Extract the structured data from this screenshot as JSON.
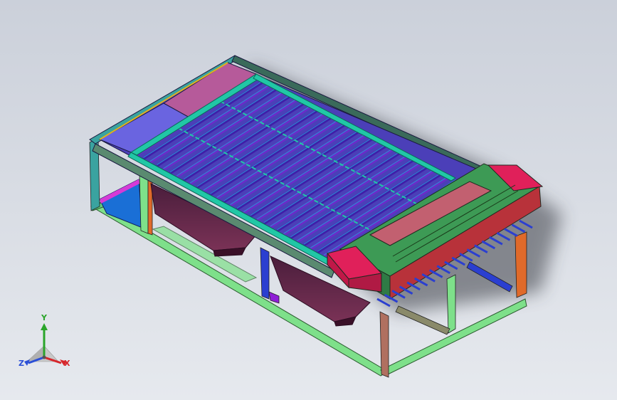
{
  "viewport": {
    "background_top": "#cbd0da",
    "background_bottom": "#e6e9ee"
  },
  "model": {
    "colors": {
      "frame_green": "#7ee08a",
      "frame_teal": "#3aa3a0",
      "leg_orange": "#e06a2a",
      "leg_blue": "#2b3fd0",
      "leg_purple": "#8f1fd6",
      "panel_blue": "#6a64e0",
      "panel_pink": "#b65a9a",
      "rollers": "#3f1fa8",
      "roller_frame": "#21c7a6",
      "hopper": "#6a2a4e",
      "gear_red": "#e0205a",
      "gear_green": "#3d9a55",
      "mid_panel": "#1a6fd6"
    }
  },
  "triad": {
    "y_label": "Y",
    "x_label": "X",
    "z_label": "Z",
    "x_color": "#d6262b",
    "y_color": "#2aa52a",
    "z_color": "#2b4fd6"
  }
}
